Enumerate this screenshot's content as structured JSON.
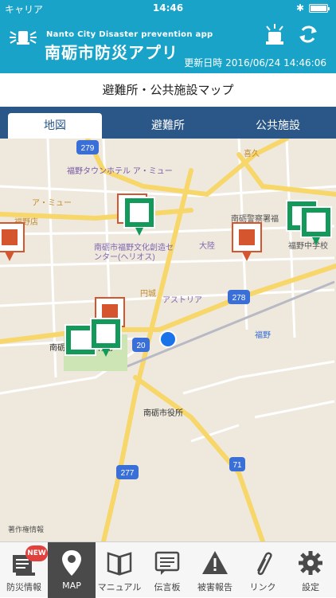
{
  "status_bar": {
    "carrier": "キャリア",
    "time": "14:46"
  },
  "header": {
    "subtitle": "Nanto City Disaster prevention app",
    "title": "南砺市防災アプリ",
    "updated": "更新日時 2016/06/24 14:46:06",
    "alarm_icon": "alarm-light-icon",
    "refresh_icon": "refresh-icon"
  },
  "page_title": "避難所・公共施設マップ",
  "tabs": [
    {
      "label": "地図",
      "active": true
    },
    {
      "label": "避難所",
      "active": false
    },
    {
      "label": "公共施設",
      "active": false
    }
  ],
  "map": {
    "labels": {
      "hotel": "福野タウンホテル ア・ミュー",
      "amyu": "ア・ミュー",
      "fukunoten": "福野店",
      "kumiai": "喜久",
      "police": "南砺警察署福",
      "school": "福野中学校",
      "heriosu1": "南砺市福野文化創造セ",
      "heriosu2": "ンター(ヘリオス)",
      "osaka": "大陸",
      "enjo": "円城",
      "astoria": "アストリア",
      "cityhall": "南砺市役所",
      "fukuno": "福野",
      "gym": "南砺市福野体育館",
      "copyright": "著作権情報"
    },
    "route_badges": [
      "279",
      "278",
      "20",
      "277",
      "71"
    ],
    "colors": {
      "shelter": "#139a5a",
      "facility": "#d4552e",
      "current_location": "#1a73e8",
      "road_major": "#f7d66a",
      "road_minor": "#ffffff"
    }
  },
  "tabbar": [
    {
      "label": "防災情報",
      "icon": "disaster-info-icon",
      "badge": "NEW",
      "active": false
    },
    {
      "label": "MAP",
      "icon": "map-pin-icon",
      "active": true
    },
    {
      "label": "マニュアル",
      "icon": "book-icon",
      "active": false
    },
    {
      "label": "伝言板",
      "icon": "message-board-icon",
      "active": false
    },
    {
      "label": "被害報告",
      "icon": "warning-icon",
      "active": false
    },
    {
      "label": "リンク",
      "icon": "link-icon",
      "active": false
    },
    {
      "label": "設定",
      "icon": "gear-icon",
      "active": false
    }
  ]
}
